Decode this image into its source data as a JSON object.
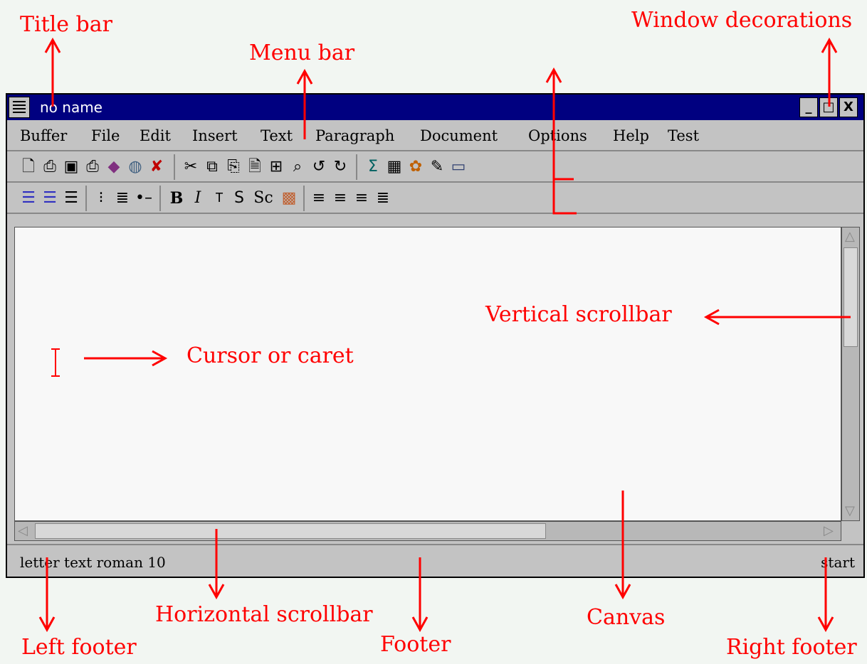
{
  "window": {
    "title": "no name",
    "decorations": {
      "minimize": "_",
      "maximize": "□",
      "close": "X"
    }
  },
  "menubar": [
    "Buffer",
    "File",
    "Edit",
    "Insert",
    "Text",
    "Paragraph",
    "Document",
    "Options",
    "Help",
    "Test"
  ],
  "toolbar_main": [
    "new-icon",
    "open-icon",
    "save-icon",
    "print-icon",
    "books-icon",
    "globe-icon",
    "close-icon",
    "cut-icon",
    "copy-icon",
    "paste-icon",
    "preview-icon",
    "spell-icon",
    "find-icon",
    "undo-icon",
    "redo-icon",
    "math-icon",
    "table-icon",
    "image-icon",
    "pen-icon",
    "monitor-icon"
  ],
  "toolbar_format": {
    "bold": "B",
    "italic": "I",
    "typewriter": "T",
    "sans": "S",
    "smallcaps": "Sc"
  },
  "footer": {
    "left": "letter text roman 10",
    "right": "start"
  },
  "annotations": {
    "title_bar": "Title bar",
    "menu_bar": "Menu bar",
    "window_decorations": "Window decorations",
    "vertical_scrollbar": "Vertical scrollbar",
    "cursor": "Cursor or caret",
    "horizontal_scrollbar": "Horizontal scrollbar",
    "canvas": "Canvas",
    "left_footer": "Left footer",
    "footer": "Footer",
    "right_footer": "Right footer"
  },
  "colors": {
    "annotation": "#ff0000",
    "titlebar": "#000080",
    "window": "#c3c3c3",
    "canvas": "#f8f8f8"
  }
}
